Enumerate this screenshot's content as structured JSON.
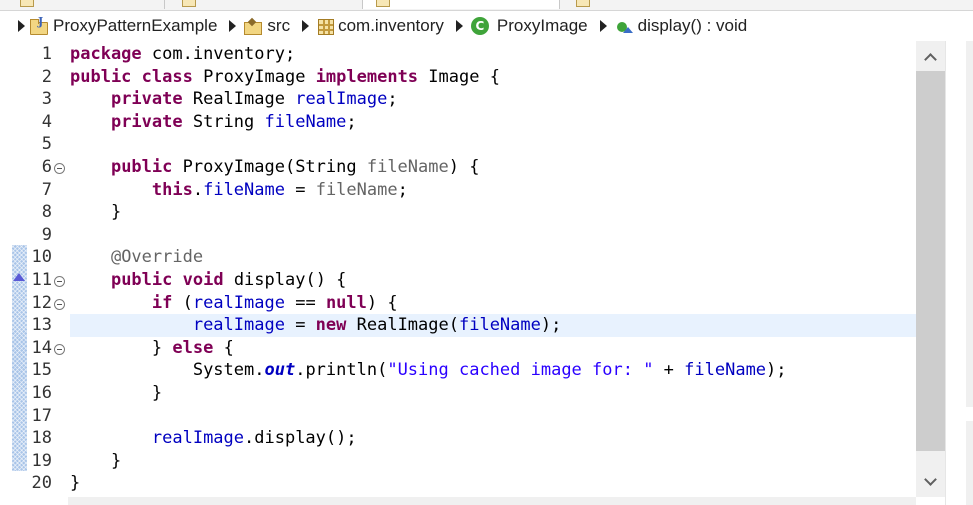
{
  "breadcrumb": {
    "project": "ProxyPatternExample",
    "src": "src",
    "package": "com.inventory",
    "class": "ProxyImage",
    "method": "display() : void",
    "icons": [
      "project-folder-icon",
      "source-folder-icon",
      "package-icon",
      "class-icon",
      "public-method-icon"
    ]
  },
  "icons": {
    "class_icon_letter": "C"
  },
  "editor": {
    "current_line": 13,
    "lines": [
      {
        "n": "1"
      },
      {
        "n": "2"
      },
      {
        "n": "3"
      },
      {
        "n": "4"
      },
      {
        "n": "5"
      },
      {
        "n": "6"
      },
      {
        "n": "7"
      },
      {
        "n": "8"
      },
      {
        "n": "9"
      },
      {
        "n": "10"
      },
      {
        "n": "11"
      },
      {
        "n": "12"
      },
      {
        "n": "13"
      },
      {
        "n": "14"
      },
      {
        "n": "15"
      },
      {
        "n": "16"
      },
      {
        "n": "17"
      },
      {
        "n": "18"
      },
      {
        "n": "19"
      },
      {
        "n": "20"
      }
    ],
    "code": {
      "l1": {
        "kw": "package",
        "rest": " com.inventory;"
      },
      "l2": {
        "kw1": "public",
        "kw2": "class",
        "name": " ProxyImage ",
        "kw3": "implements",
        "rest": " Image {"
      },
      "l3": {
        "kw": "private",
        "type": " RealImage ",
        "fld": "realImage",
        "rest": ";"
      },
      "l4": {
        "kw": "private",
        "type": " String ",
        "fld": "fileName",
        "rest": ";"
      },
      "l6": {
        "kw": "public",
        "sig": " ProxyImage(String ",
        "param": "fileName",
        "rest": ") {"
      },
      "l7": {
        "kw": "this",
        "dot": ".",
        "fld": "fileName",
        "eq": " = ",
        "param": "fileName",
        "rest": ";"
      },
      "l8": {
        "rest": "}"
      },
      "l10": {
        "ann": "@Override"
      },
      "l11": {
        "kw1": "public",
        "kw2": "void",
        "rest": " display() {"
      },
      "l12": {
        "kw": "if",
        "open": " (",
        "fld": "realImage",
        "eq": " == ",
        "kw2": "null",
        "rest": ") {"
      },
      "l13": {
        "fld": "realImage",
        "eq": " = ",
        "kw": "new",
        "mid": " RealImage(",
        "fld2": "fileName",
        "rest": ");"
      },
      "l14": {
        "open": "} ",
        "kw": "else",
        "rest": " {"
      },
      "l15": {
        "pre": "System.",
        "sfld": "out",
        "mid": ".println(",
        "str": "\"Using cached image for: \"",
        "plus": " + ",
        "fld": "fileName",
        "rest": ");"
      },
      "l16": {
        "rest": "}"
      },
      "l18": {
        "fld": "realImage",
        "rest": ".display();"
      },
      "l19": {
        "rest": "}"
      },
      "l20": {
        "rest": "}"
      }
    }
  },
  "colors": {
    "keyword": "#7f0055",
    "field": "#0000c0",
    "string": "#2a00ff",
    "annotation": "#646464",
    "current_line_bg": "#e8f2fe",
    "change_ruler": "#a8c4e8",
    "class_icon": "#3fa43a"
  }
}
